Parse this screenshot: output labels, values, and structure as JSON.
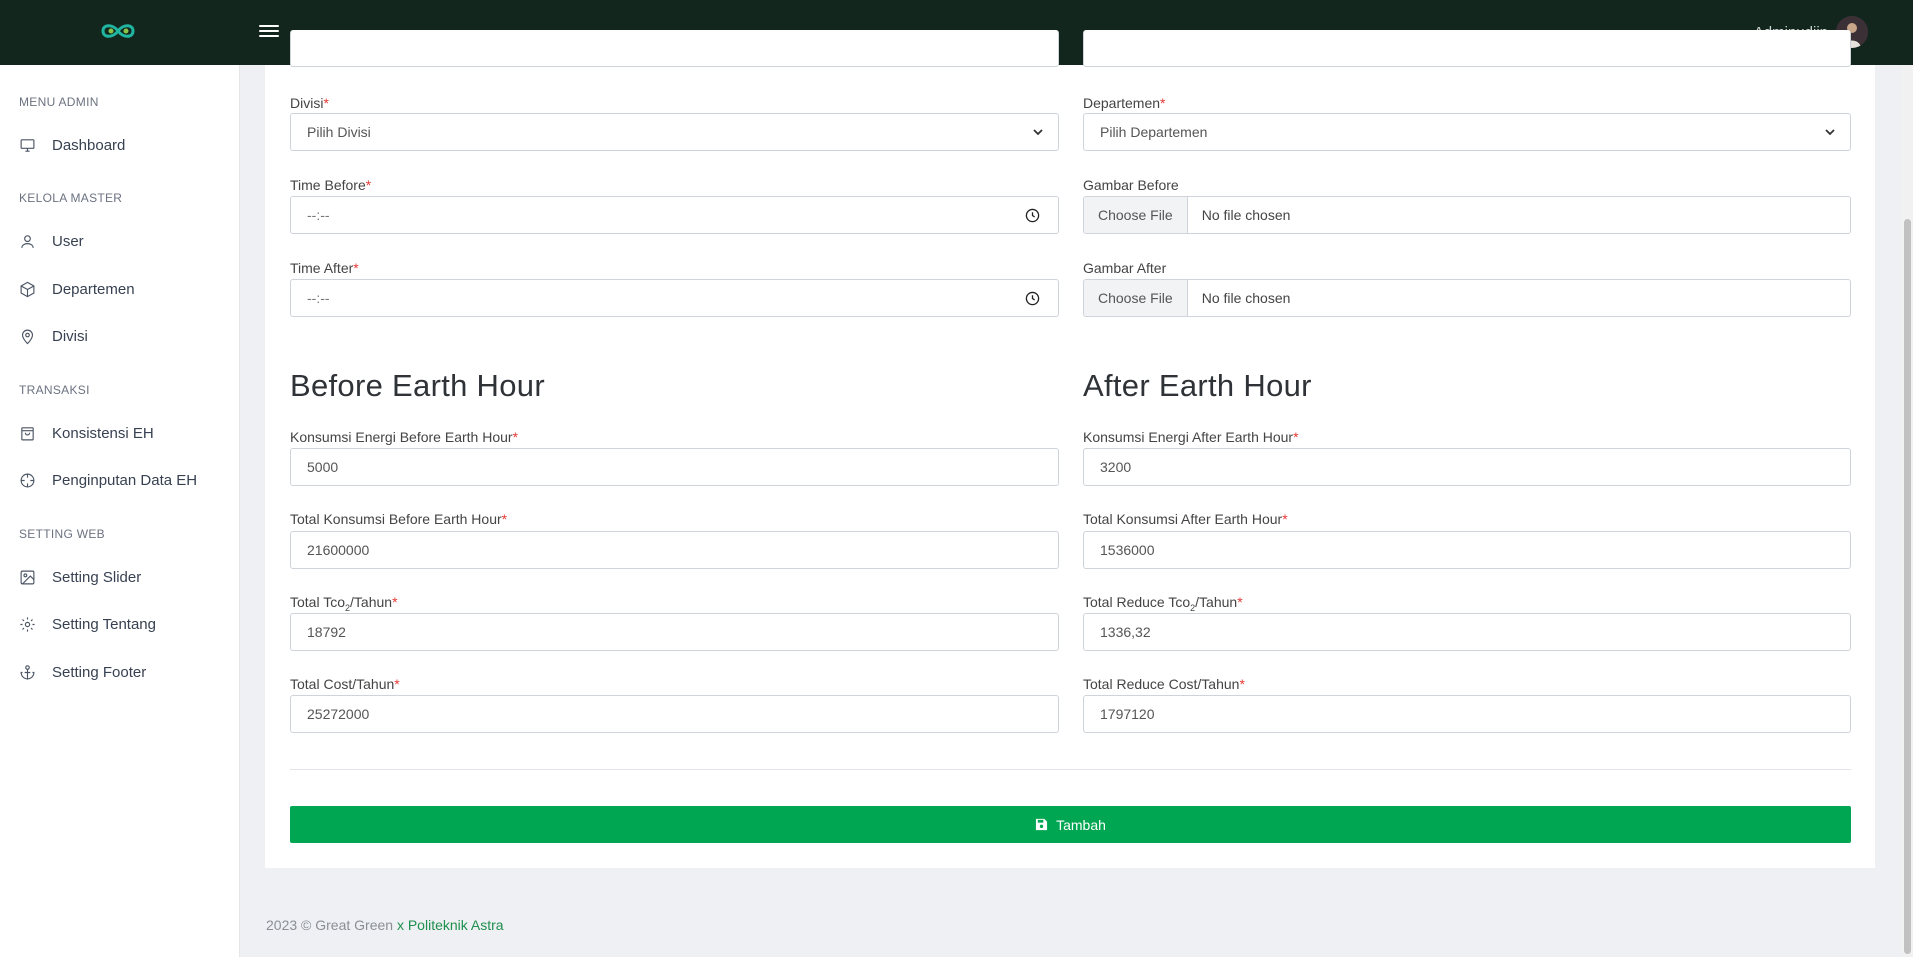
{
  "header": {
    "user_name": "Adminudiin",
    "icons": [
      "logo-icon",
      "hamburger-icon",
      "chevron-down-icon",
      "avatar"
    ]
  },
  "sidebar": {
    "sections": [
      {
        "title": "MENU ADMIN",
        "items": [
          {
            "label": "Dashboard",
            "icon": "monitor-icon"
          }
        ]
      },
      {
        "title": "KELOLA MASTER",
        "items": [
          {
            "label": "User",
            "icon": "user-icon"
          },
          {
            "label": "Departemen",
            "icon": "box-icon"
          },
          {
            "label": "Divisi",
            "icon": "map-pin-icon"
          }
        ]
      },
      {
        "title": "TRANSAKSI",
        "items": [
          {
            "label": "Konsistensi EH",
            "icon": "shopping-bag-icon"
          },
          {
            "label": "Penginputan Data EH",
            "icon": "crosshair-icon"
          }
        ]
      },
      {
        "title": "SETTING WEB",
        "items": [
          {
            "label": "Setting Slider",
            "icon": "image-icon"
          },
          {
            "label": "Setting Tentang",
            "icon": "gear-icon"
          },
          {
            "label": "Setting Footer",
            "icon": "anchor-icon"
          }
        ]
      }
    ]
  },
  "form": {
    "divisi": {
      "label": "Divisi",
      "value": "Pilih Divisi"
    },
    "departemen": {
      "label": "Departemen",
      "value": "Pilih Departemen"
    },
    "time_before": {
      "label": "Time Before",
      "value": "--:--"
    },
    "gambar_before": {
      "label": "Gambar Before",
      "button": "Choose File",
      "file": "No file chosen"
    },
    "time_after": {
      "label": "Time After",
      "value": "--:--"
    },
    "gambar_after": {
      "label": "Gambar After",
      "button": "Choose File",
      "file": "No file chosen"
    },
    "before_title": "Before Earth Hour",
    "after_title": "After Earth Hour",
    "konsumsi_before": {
      "label": "Konsumsi Energi Before Earth Hour",
      "value": "5000"
    },
    "konsumsi_after": {
      "label": "Konsumsi Energi After Earth Hour",
      "value": "3200"
    },
    "total_konsumsi_before": {
      "label": "Total Konsumsi Before Earth Hour",
      "value": "21600000"
    },
    "total_konsumsi_after": {
      "label": "Total Konsumsi After Earth Hour",
      "value": "1536000"
    },
    "total_tco2": {
      "label_pre": "Total Tco",
      "label_sub": "2",
      "label_post": "/Tahun",
      "value": "18792"
    },
    "total_reduce_tco2": {
      "label_pre": "Total Reduce Tco",
      "label_sub": "2",
      "label_post": "/Tahun",
      "value": "1336,32"
    },
    "total_cost": {
      "label": "Total Cost/Tahun",
      "value": "25272000"
    },
    "total_reduce_cost": {
      "label": "Total Reduce Cost/Tahun",
      "value": "1797120"
    },
    "submit_label": "Tambah",
    "required_mark": "*"
  },
  "footer": {
    "text": "2023 © Great Green",
    "brand": "x Politeknik Astra"
  },
  "colors": {
    "topbar": "#12261e",
    "accent": "#00a651",
    "required": "#e53935"
  }
}
